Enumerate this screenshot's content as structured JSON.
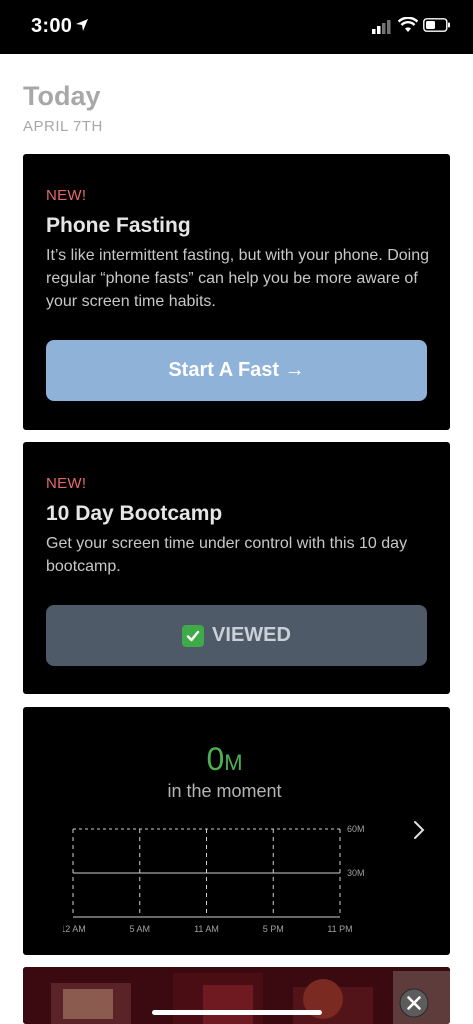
{
  "status_bar": {
    "time": "3:00",
    "icons": [
      "location-arrow-icon",
      "signal-icon",
      "wifi-icon",
      "battery-icon"
    ]
  },
  "header": {
    "title": "Today",
    "date": "APRIL 7TH"
  },
  "cards": [
    {
      "badge": "NEW!",
      "title": "Phone Fasting",
      "description": "It’s like intermittent fasting, but with your phone. Doing regular “phone fasts” can help you be more aware of your screen time habits.",
      "button_label": "Start A Fast →"
    },
    {
      "badge": "NEW!",
      "title": "10 Day Bootcamp",
      "description": "Get your screen time under control with this 10 day bootcamp.",
      "button_label": "VIEWED",
      "button_icon": "check-box-icon"
    }
  ],
  "usage": {
    "value": "0",
    "unit": "M",
    "caption": "in the moment",
    "chart_data": {
      "type": "bar",
      "x_ticks": [
        "12 AM",
        "5 AM",
        "11 AM",
        "5 PM",
        "11 PM"
      ],
      "y_ticks": [
        "60M",
        "30M"
      ],
      "values": [],
      "ylim": [
        0,
        60
      ]
    }
  },
  "colors": {
    "accent_blue": "#8fb2d9",
    "new_badge": "#e46a6a",
    "usage_green": "#4caf50",
    "viewed_button": "#4e5a68"
  }
}
